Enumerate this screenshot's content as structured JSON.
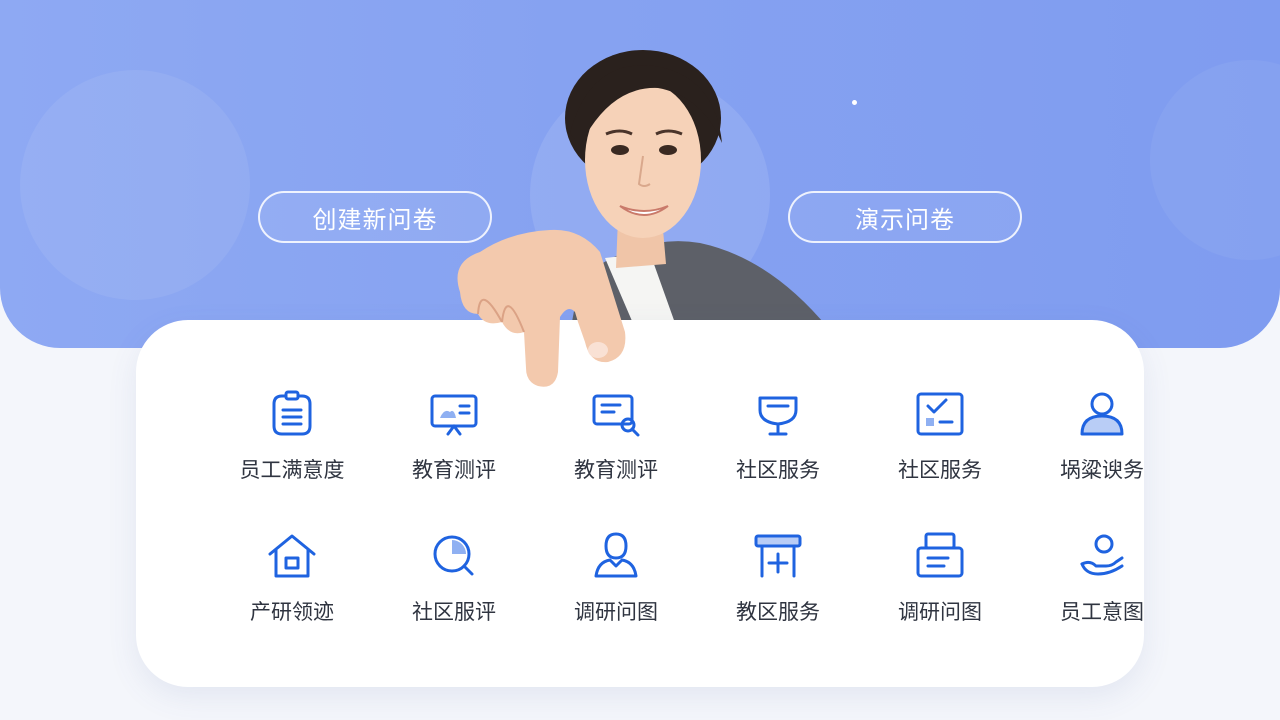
{
  "hero": {
    "create_label": "创建新问卷",
    "demo_label": "演示问卷",
    "accent_color": "#86a2f1"
  },
  "services": {
    "icon_color": "#1f63e0",
    "items": [
      {
        "label": "员工满意度",
        "icon": "clipboard-icon"
      },
      {
        "label": "教育测评",
        "icon": "presentation-board-icon"
      },
      {
        "label": "教育测评",
        "icon": "certificate-search-icon"
      },
      {
        "label": "社区服务",
        "icon": "shield-stand-icon"
      },
      {
        "label": "社区服务",
        "icon": "checkbox-form-icon"
      },
      {
        "label": "埚粱谀务",
        "icon": "user-icon"
      },
      {
        "label": "产研领迹",
        "icon": "house-icon"
      },
      {
        "label": "社区服评",
        "icon": "magnifier-icon"
      },
      {
        "label": "调研问图",
        "icon": "person-bust-icon"
      },
      {
        "label": "教区服务",
        "icon": "board-plus-icon"
      },
      {
        "label": "调研问图",
        "icon": "document-tray-icon"
      },
      {
        "label": "员工意图",
        "icon": "hand-user-icon"
      }
    ]
  }
}
